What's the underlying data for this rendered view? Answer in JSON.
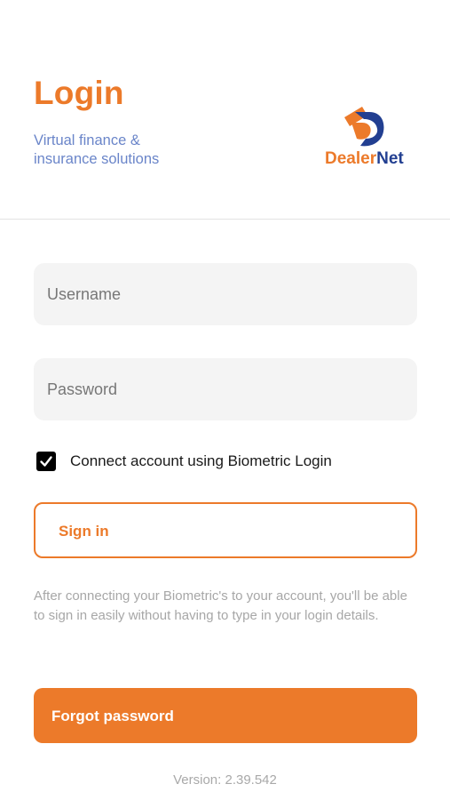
{
  "header": {
    "title": "Login",
    "subtitle_line1": "Virtual finance &",
    "subtitle_line2": "insurance solutions",
    "logo": {
      "icon": "dealernet-logo-icon",
      "text_dealer": "Dealer",
      "text_net": "Net"
    }
  },
  "form": {
    "username_placeholder": "Username",
    "password_placeholder": "Password",
    "biometric": {
      "checked": true,
      "label": "Connect account using Biometric Login"
    },
    "signin_label": "Sign in",
    "info_text": "After connecting your Biometric's to your account, you'll be able to sign in easily without having to type in your login details.",
    "forgot_label": "Forgot password"
  },
  "footer": {
    "version": "Version: 2.39.542"
  },
  "colors": {
    "accent": "#ec7a2a",
    "brand_blue": "#223f91",
    "subtitle": "#6a85c9"
  }
}
